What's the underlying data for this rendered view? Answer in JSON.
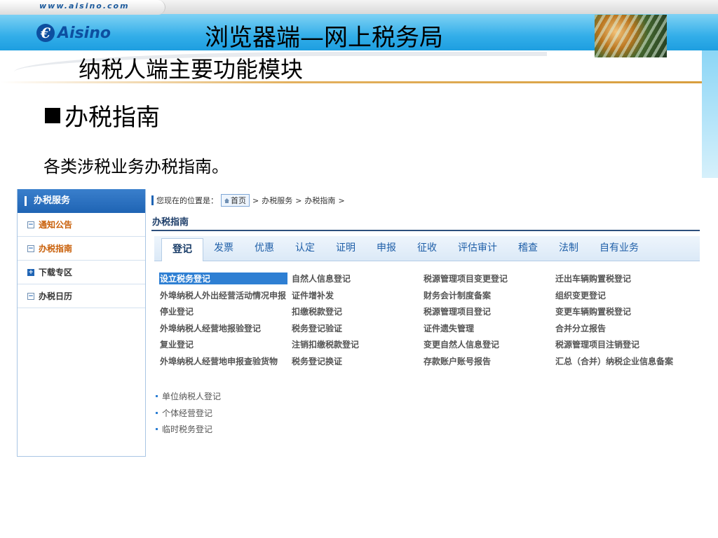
{
  "header": {
    "url": "www.aisino.com",
    "logo_text": "Aisino",
    "logo_mark": "€",
    "title_line1": "浏览器端—网上税务局",
    "title_line2": "纳税人端主要功能模块"
  },
  "section": {
    "heading": "办税指南",
    "description": "各类涉税业务办税指南。"
  },
  "screenshot": {
    "sidebar": {
      "title": "办税服务",
      "items": [
        {
          "label": "通知公告",
          "icon": "minus-box-icon"
        },
        {
          "label": "办税指南",
          "icon": "minus-box-icon"
        },
        {
          "label": "下载专区",
          "icon": "plus-box-icon"
        },
        {
          "label": "办税日历",
          "icon": "minus-box-icon"
        }
      ]
    },
    "breadcrumb": {
      "prefix": "您现在的位置是：",
      "home": "首页",
      "sep": ">",
      "crumb1": "办税服务",
      "crumb2": "办税指南"
    },
    "page_title": "办税指南",
    "tabs": [
      "登记",
      "发票",
      "优惠",
      "认定",
      "证明",
      "申报",
      "征收",
      "评估审计",
      "稽查",
      "法制",
      "自有业务"
    ],
    "active_tab": "登记",
    "grid": [
      [
        "设立税务登记",
        "自然人信息登记",
        "税源管理项目变更登记",
        "迁出车辆购置税登记"
      ],
      [
        "外埠纳税人外出经营活动情况申报",
        "证件增补发",
        "财务会计制度备案",
        "组织变更登记"
      ],
      [
        "停业登记",
        "扣缴税款登记",
        "税源管理项目登记",
        "变更车辆购置税登记"
      ],
      [
        "外埠纳税人经营地报验登记",
        "税务登记验证",
        "证件遗失管理",
        "合并分立报告"
      ],
      [
        "复业登记",
        "注销扣缴税款登记",
        "变更自然人信息登记",
        "税源管理项目注销登记"
      ],
      [
        "外埠纳税人经营地申报查验货物",
        "税务登记换证",
        "存款账户账号报告",
        "汇总（合并）纳税企业信息备案"
      ]
    ],
    "list": [
      "单位纳税人登记",
      "个体经营登记",
      "临时税务登记"
    ]
  },
  "colors": {
    "banner": "#33aee9",
    "logo": "#0d4fa0",
    "sidebar_head": "#1f64b4",
    "selected": "#2e7fd3",
    "orange_link": "#c9600a"
  }
}
